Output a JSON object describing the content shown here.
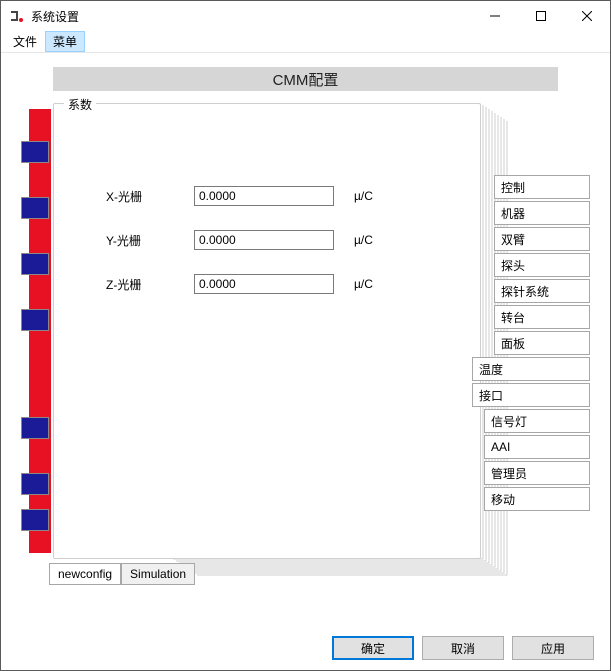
{
  "window": {
    "title": "系统设置"
  },
  "menubar": {
    "file": "文件",
    "menu": "菜单"
  },
  "banner": "CMM配置",
  "panel": {
    "legend": "系数",
    "rows": [
      {
        "label": "X-光栅",
        "value": "0.0000",
        "unit": "µ/C"
      },
      {
        "label": "Y-光栅",
        "value": "0.0000",
        "unit": "µ/C"
      },
      {
        "label": "Z-光栅",
        "value": "0.0000",
        "unit": "µ/C"
      }
    ]
  },
  "side_tabs_group1": [
    "控制",
    "机器",
    "双臂",
    "探头",
    "探针系统",
    "转台",
    "面板"
  ],
  "side_tabs_header1": "温度",
  "side_tabs_header2": "接口",
  "side_tabs_group2": [
    "信号灯",
    "AAI",
    "管理员",
    "移动"
  ],
  "bottom_tabs": [
    "newconfig",
    "Simulation"
  ],
  "footer": {
    "ok": "确定",
    "cancel": "取消",
    "apply": "应用"
  }
}
